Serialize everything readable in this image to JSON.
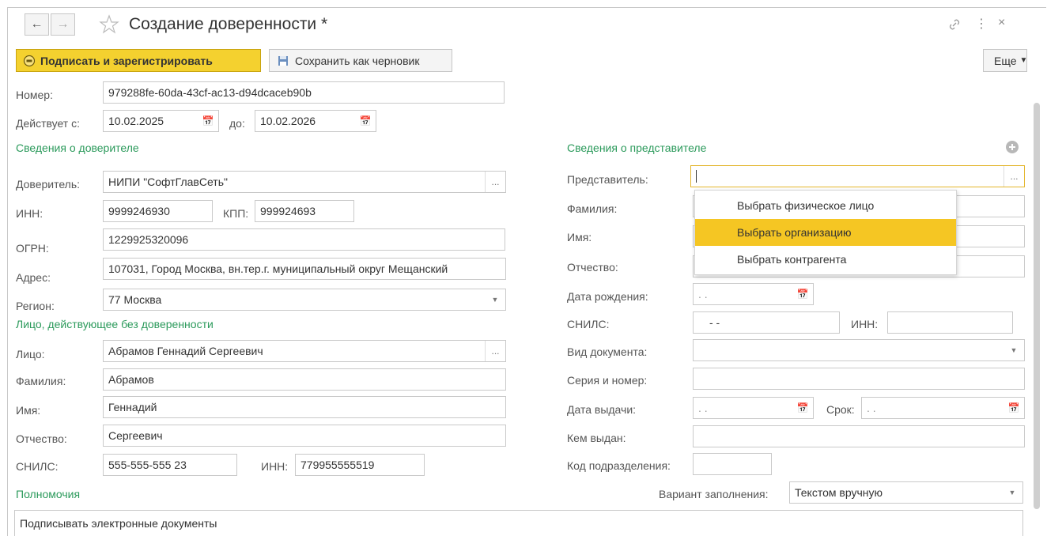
{
  "window": {
    "title": "Создание доверенности *"
  },
  "toolbar": {
    "sign_label": "Подписать и зарегистрировать",
    "draft_label": "Сохранить как черновик",
    "more_label": "Еще"
  },
  "header": {
    "number_label": "Номер:",
    "number_value": "979288fe-60da-43cf-ac13-d94dcaceb90b",
    "valid_from_label": "Действует с:",
    "valid_from_value": "10.02.2025",
    "valid_to_label": "до:",
    "valid_to_value": "10.02.2026"
  },
  "principal": {
    "section_title": "Сведения о доверителе",
    "principal_label": "Доверитель:",
    "principal_value": "НИПИ \"СофтГлавСеть\"",
    "inn_label": "ИНН:",
    "inn_value": "9999246930",
    "kpp_label": "КПП:",
    "kpp_value": "999924693",
    "ogrn_label": "ОГРН:",
    "ogrn_value": "1229925320096",
    "address_label": "Адрес:",
    "address_value": "107031, Город Москва, вн.тер.г. муниципальный округ Мещанский",
    "region_label": "Регион:",
    "region_value": "77 Москва"
  },
  "acting_person": {
    "section_title": "Лицо, действующее без доверенности",
    "person_label": "Лицо:",
    "person_value": "Абрамов Геннадий Сергеевич",
    "last_name_label": "Фамилия:",
    "last_name_value": "Абрамов",
    "first_name_label": "Имя:",
    "first_name_value": "Геннадий",
    "patronymic_label": "Отчество:",
    "patronymic_value": "Сергеевич",
    "snils_label": "СНИЛС:",
    "snils_value": "555-555-555 23",
    "inn_label": "ИНН:",
    "inn_value": "779955555519"
  },
  "representative": {
    "section_title": "Сведения о представителе",
    "rep_label": "Представитель:",
    "rep_value": "",
    "last_name_label": "Фамилия:",
    "first_name_label": "Имя:",
    "patronymic_label": "Отчество:",
    "birth_date_label": "Дата рождения:",
    "birth_date_value": ". .",
    "snils_label": "СНИЛС:",
    "snils_value": "- -",
    "inn_label": "ИНН:",
    "doc_type_label": "Вид документа:",
    "series_label": "Серия и номер:",
    "issue_date_label": "Дата выдачи:",
    "issue_date_value": ". .",
    "term_label": "Срок:",
    "term_value": ". .",
    "issued_by_label": "Кем выдан:",
    "division_code_label": "Код подразделения:"
  },
  "dropdown_menu": {
    "items": [
      "Выбрать физическое лицо",
      "Выбрать организацию",
      "Выбрать контрагента"
    ],
    "selected_index": 1
  },
  "powers": {
    "section_title": "Полномочия",
    "fill_mode_label": "Вариант заполнения:",
    "fill_mode_value": "Текстом вручную",
    "text_value": "Подписывать электронные документы"
  },
  "colors": {
    "accent_yellow": "#f4d12f",
    "menu_selected": "#f5c623",
    "section_green": "#2b9a5b",
    "field_border": "#c9c9c9"
  }
}
